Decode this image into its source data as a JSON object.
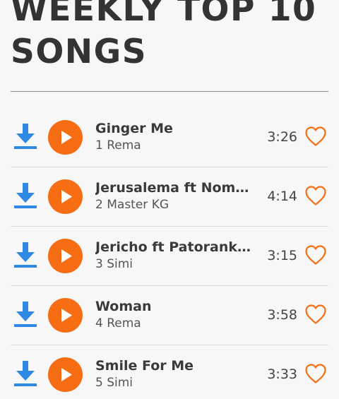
{
  "header": {
    "title_line1": "WEEKLY TOP 10",
    "title_line2": "SONGS"
  },
  "colors": {
    "accent": "#f76d14",
    "download": "#2f8ae6",
    "text": "#333333"
  },
  "songs": [
    {
      "title": "Ginger Me",
      "rank": "1",
      "artist": "Rema",
      "duration": "3:26"
    },
    {
      "title": "Jerusalema ft Nomcebo Zikode",
      "rank": "2",
      "artist": "Master KG",
      "duration": "4:14"
    },
    {
      "title": "Jericho ft Patoranking",
      "rank": "3",
      "artist": "Simi",
      "duration": "3:15"
    },
    {
      "title": "Woman",
      "rank": "4",
      "artist": "Rema",
      "duration": "3:58"
    },
    {
      "title": "Smile For Me",
      "rank": "5",
      "artist": "Simi",
      "duration": "3:33"
    }
  ],
  "icons": {
    "download": "download-icon",
    "play": "play-icon",
    "favorite": "heart-icon"
  }
}
